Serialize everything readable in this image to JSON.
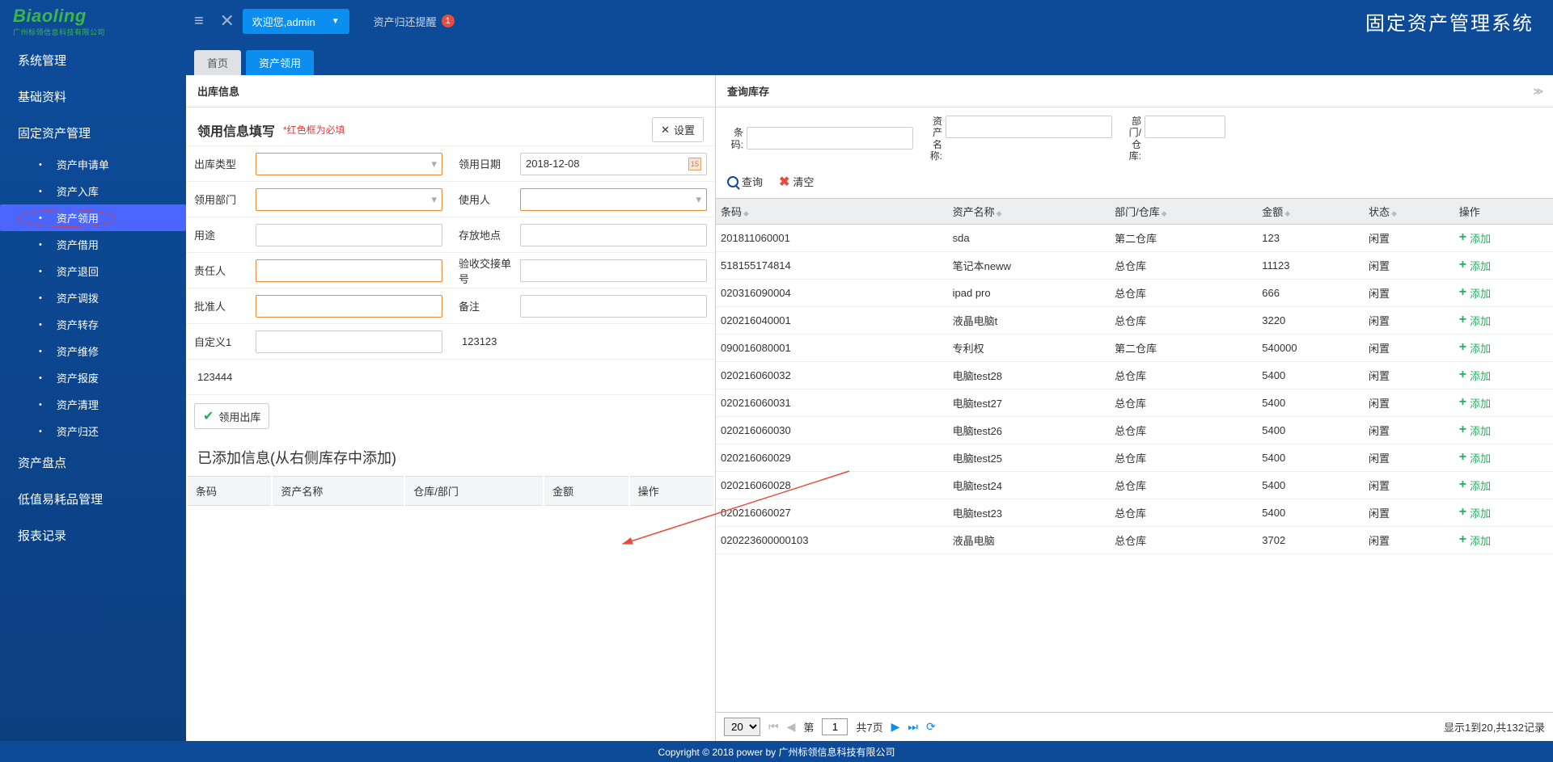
{
  "header": {
    "logo_top": "Biaoling",
    "logo_bottom": "广州标领信息科技有限公司",
    "welcome": "欢迎您,admin",
    "remind": "资产归还提醒",
    "remind_count": "1",
    "app_title": "固定资产管理系统"
  },
  "sidebar": {
    "groups": [
      {
        "label": "系统管理"
      },
      {
        "label": "基础资料"
      },
      {
        "label": "固定资产管理",
        "subs": [
          {
            "label": "资产申请单"
          },
          {
            "label": "资产入库"
          },
          {
            "label": "资产领用",
            "active": true
          },
          {
            "label": "资产借用"
          },
          {
            "label": "资产退回"
          },
          {
            "label": "资产调拨"
          },
          {
            "label": "资产转存"
          },
          {
            "label": "资产维修"
          },
          {
            "label": "资产报废"
          },
          {
            "label": "资产清理"
          },
          {
            "label": "资产归还"
          }
        ]
      },
      {
        "label": "资产盘点"
      },
      {
        "label": "低值易耗品管理"
      },
      {
        "label": "报表记录"
      }
    ]
  },
  "tabs": [
    {
      "label": "首页"
    },
    {
      "label": "资产领用",
      "active": true
    }
  ],
  "left": {
    "panel_title": "出库信息",
    "form_title": "领用信息填写",
    "required_note": "*红色框为必填",
    "settings": "设置",
    "fields": {
      "out_type": "出库类型",
      "receive_date": "领用日期",
      "receive_date_val": "2018-12-08",
      "receive_dept": "领用部门",
      "user": "使用人",
      "purpose": "用途",
      "storage_loc": "存放地点",
      "responsible": "责任人",
      "accept_no": "验收交接单号",
      "approver": "批准人",
      "remark": "备注",
      "custom1": "自定义1",
      "fixed1": "123123",
      "fixed2": "123444"
    },
    "submit": "领用出库",
    "added_title": "已添加信息(从右侧库存中添加)",
    "added_cols": [
      "条码",
      "资产名称",
      "仓库/部门",
      "金额",
      "操作"
    ]
  },
  "right": {
    "panel_title": "查询库存",
    "search": {
      "barcode": "条码:",
      "asset_name": "资\n产\n名\n称:",
      "dept_wh": "部\n门/\n仓\n库:"
    },
    "query": "查询",
    "clear": "清空",
    "cols": [
      "条码",
      "资产名称",
      "部门/仓库",
      "金额",
      "状态",
      "操作"
    ],
    "add_label": "添加",
    "rows": [
      {
        "code": "201811060001",
        "name": "sda",
        "wh": "第二仓库",
        "amt": "123",
        "st": "闲置"
      },
      {
        "code": "518155174814",
        "name": "笔记本neww",
        "wh": "总仓库",
        "amt": "11123",
        "st": "闲置"
      },
      {
        "code": "020316090004",
        "name": "ipad pro",
        "wh": "总仓库",
        "amt": "666",
        "st": "闲置"
      },
      {
        "code": "020216040001",
        "name": "液晶电脑t",
        "wh": "总仓库",
        "amt": "3220",
        "st": "闲置"
      },
      {
        "code": "090016080001",
        "name": "专利权",
        "wh": "第二仓库",
        "amt": "540000",
        "st": "闲置"
      },
      {
        "code": "020216060032",
        "name": "电脑test28",
        "wh": "总仓库",
        "amt": "5400",
        "st": "闲置"
      },
      {
        "code": "020216060031",
        "name": "电脑test27",
        "wh": "总仓库",
        "amt": "5400",
        "st": "闲置"
      },
      {
        "code": "020216060030",
        "name": "电脑test26",
        "wh": "总仓库",
        "amt": "5400",
        "st": "闲置"
      },
      {
        "code": "020216060029",
        "name": "电脑test25",
        "wh": "总仓库",
        "amt": "5400",
        "st": "闲置"
      },
      {
        "code": "020216060028",
        "name": "电脑test24",
        "wh": "总仓库",
        "amt": "5400",
        "st": "闲置"
      },
      {
        "code": "020216060027",
        "name": "电脑test23",
        "wh": "总仓库",
        "amt": "5400",
        "st": "闲置"
      },
      {
        "code": "020223600000103",
        "name": "液晶电脑",
        "wh": "总仓库",
        "amt": "3702",
        "st": "闲置"
      }
    ],
    "pager": {
      "size": "20",
      "page_label_pre": "第",
      "page": "1",
      "page_label_post": "共7页",
      "info": "显示1到20,共132记录"
    }
  },
  "footer": "Copyright © 2018 power by 广州标领信息科技有限公司"
}
